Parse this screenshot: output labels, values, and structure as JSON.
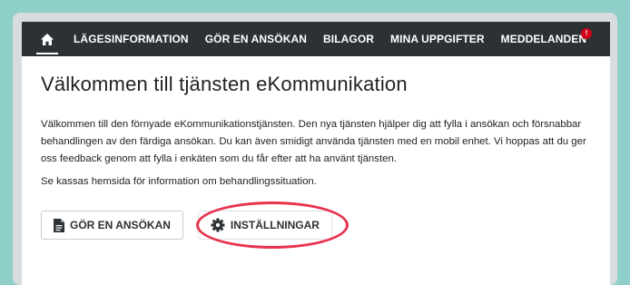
{
  "nav": {
    "items": [
      {
        "label": "LÄGESINFORMATION"
      },
      {
        "label": "GÖR EN ANSÖKAN"
      },
      {
        "label": "BILAGOR"
      },
      {
        "label": "MINA UPPGIFTER"
      },
      {
        "label": "MEDDELANDEN",
        "badge": "!"
      }
    ]
  },
  "main": {
    "title": "Välkommen till tjänsten eKommunikation",
    "paragraph1": "Välkommen till den förnyade eKommunikationstjänsten. Den nya tjänsten hjälper dig att fylla i ansökan och försnabbar behandlingen av den färdiga ansökan. Du kan även smidigt använda tjänsten med en mobil enhet. Vi hoppas att du ger oss feedback genom att fylla i enkäten som du får efter att ha använt tjänsten.",
    "paragraph2": "Se kassas hemsida för information om behandlingssituation.",
    "buttons": {
      "apply_label": "GÖR EN ANSÖKAN",
      "settings_label": "INSTÄLLNINGAR"
    }
  },
  "colors": {
    "background": "#8ecfc9",
    "nav": "#2c3134",
    "highlight": "#e8334d",
    "badge": "#d0021b"
  },
  "icons": [
    "home-icon",
    "document-icon",
    "gear-icon"
  ]
}
